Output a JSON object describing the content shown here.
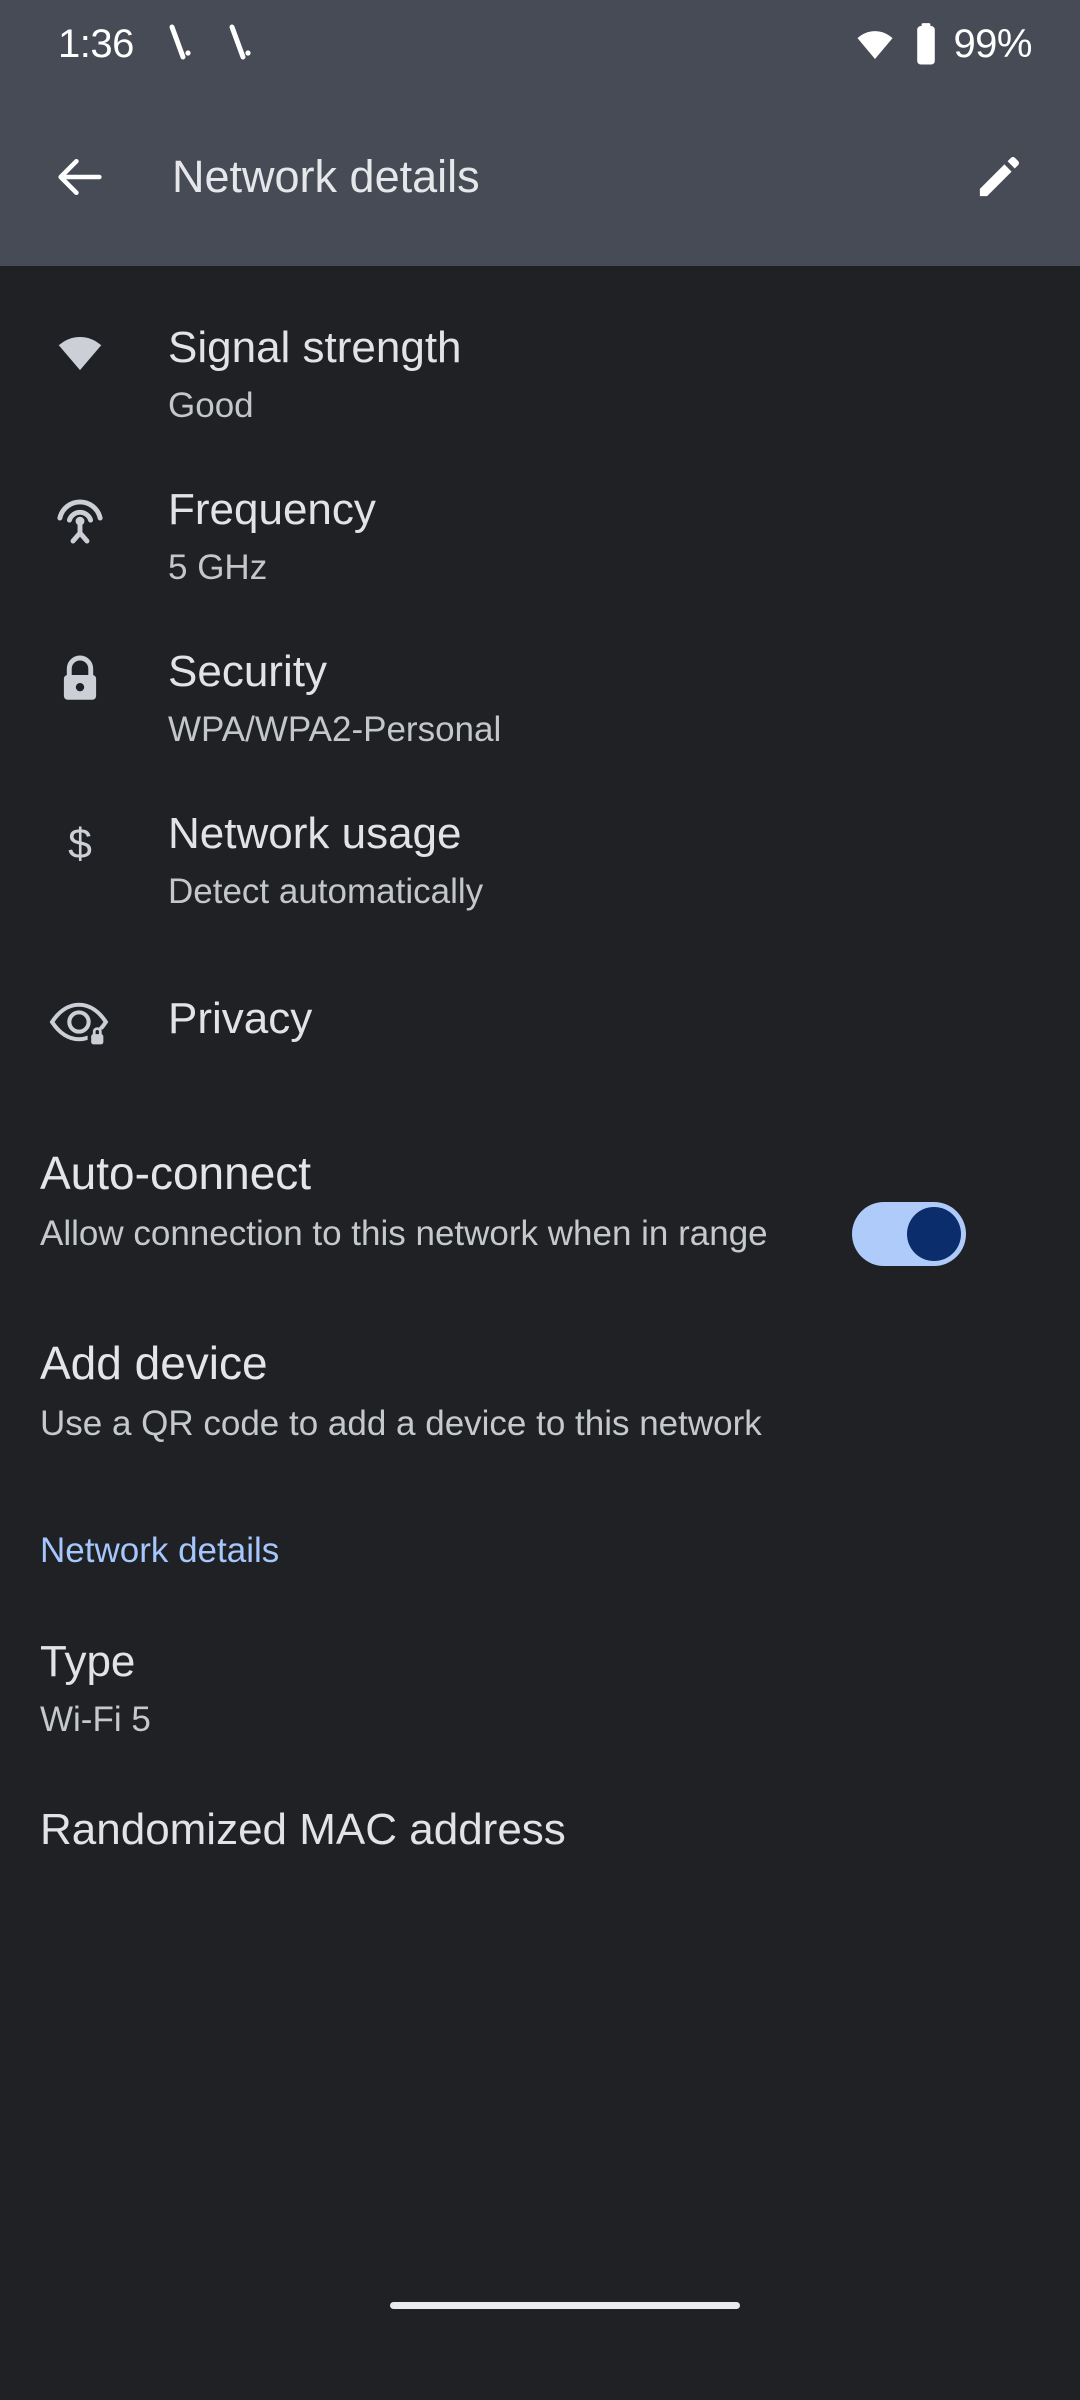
{
  "status_bar": {
    "time": "1:36",
    "notification_icons": [
      "notification-silenced-icon",
      "notification-silenced-icon"
    ],
    "wifi_icon": "wifi-icon",
    "battery_icon": "battery-full-icon",
    "battery_percent": "99%"
  },
  "app_bar": {
    "back_icon": "back-arrow-icon",
    "title": "Network details",
    "edit_icon": "edit-pencil-icon"
  },
  "rows": [
    {
      "icon": "wifi-icon",
      "title": "Signal strength",
      "subtitle": "Good"
    },
    {
      "icon": "broadcast-icon",
      "title": "Frequency",
      "subtitle": "5 GHz"
    },
    {
      "icon": "lock-icon",
      "title": "Security",
      "subtitle": "WPA/WPA2-Personal"
    },
    {
      "icon": "dollar-icon",
      "title": "Network usage",
      "subtitle": "Detect automatically"
    },
    {
      "icon": "eye-lock-icon",
      "title": "Privacy",
      "subtitle": ""
    }
  ],
  "auto_connect": {
    "title": "Auto-connect",
    "subtitle": "Allow connection to this network when in range",
    "toggle_on": true,
    "track_color": "#aecbfa",
    "thumb_color": "#0b2d6b"
  },
  "add_device": {
    "title": "Add device",
    "subtitle": "Use a QR code to add a device to this network"
  },
  "network_details_section": {
    "header": "Network details",
    "header_color": "#a5c7fd",
    "items": [
      {
        "title": "Type",
        "subtitle": "Wi-Fi 5"
      },
      {
        "title": "Randomized MAC address",
        "subtitle": ""
      }
    ]
  },
  "theme": {
    "background": "#1f2125",
    "app_bar_background": "#474b55",
    "primary_text": "#e2e3e6",
    "secondary_text": "#c6c9cc",
    "accent": "#a5c7fd"
  }
}
